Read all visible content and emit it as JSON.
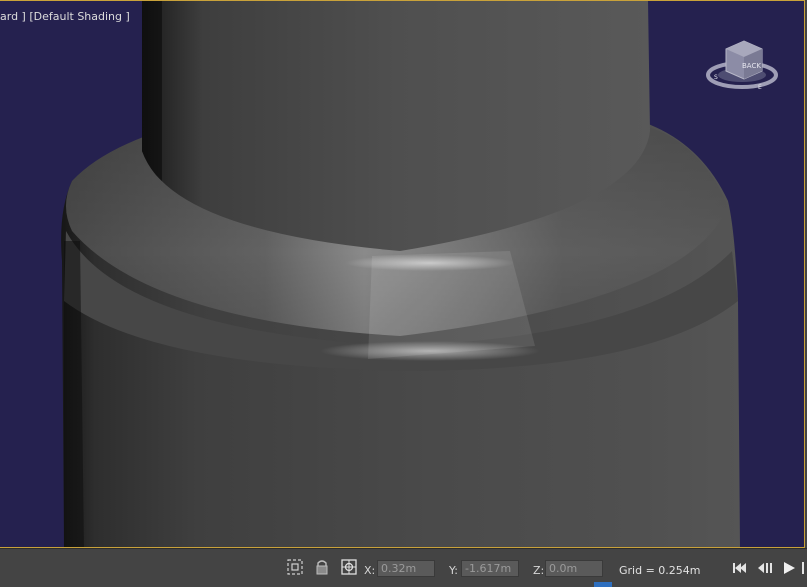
{
  "viewport": {
    "label": "ard ] [Default Shading ]",
    "background": "#25214f",
    "border_color": "#c9a23a",
    "viewcube_face": "BACK"
  },
  "status": {
    "coords": {
      "x_label": "X:",
      "x_value": "0.32m",
      "y_label": "Y:",
      "y_value": "-1.617m",
      "z_label": "Z:",
      "z_value": "0.0m"
    },
    "grid": "Grid = 0.254m",
    "icons": [
      "selection-region-icon",
      "lock-icon",
      "absolute-mode-icon"
    ]
  },
  "playback": [
    "go-to-start-icon",
    "previous-frame-icon",
    "play-icon"
  ]
}
